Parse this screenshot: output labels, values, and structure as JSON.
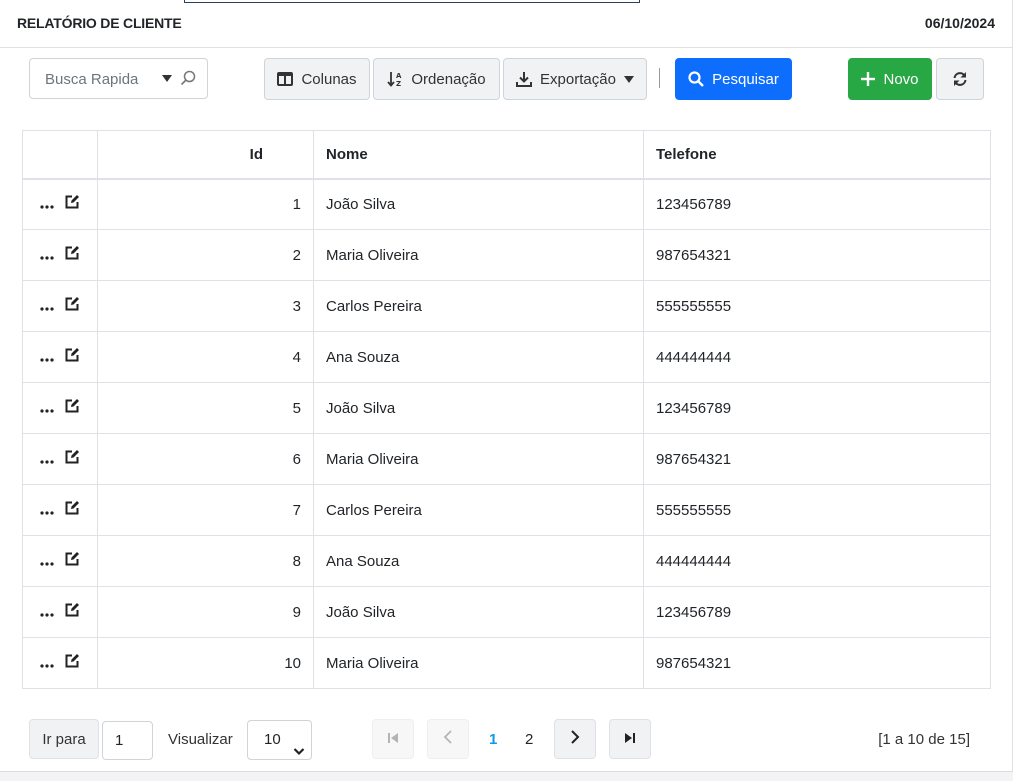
{
  "header": {
    "title": "RELATÓRIO DE CLIENTE",
    "date": "06/10/2024"
  },
  "toolbar": {
    "search_placeholder": "Busca Rapida",
    "columns_label": "Colunas",
    "sort_label": "Ordenação",
    "export_label": "Exportação",
    "search_label": "Pesquisar",
    "new_label": "Novo"
  },
  "table": {
    "columns": [
      "",
      "Id",
      "Nome",
      "Telefone"
    ],
    "rows": [
      {
        "id": "1",
        "nome": "João Silva",
        "telefone": "123456789"
      },
      {
        "id": "2",
        "nome": "Maria Oliveira",
        "telefone": "987654321"
      },
      {
        "id": "3",
        "nome": "Carlos Pereira",
        "telefone": "555555555"
      },
      {
        "id": "4",
        "nome": "Ana Souza",
        "telefone": "444444444"
      },
      {
        "id": "5",
        "nome": "João Silva",
        "telefone": "123456789"
      },
      {
        "id": "6",
        "nome": "Maria Oliveira",
        "telefone": "987654321"
      },
      {
        "id": "7",
        "nome": "Carlos Pereira",
        "telefone": "555555555"
      },
      {
        "id": "8",
        "nome": "Ana Souza",
        "telefone": "444444444"
      },
      {
        "id": "9",
        "nome": "João Silva",
        "telefone": "123456789"
      },
      {
        "id": "10",
        "nome": "Maria Oliveira",
        "telefone": "987654321"
      }
    ]
  },
  "footer": {
    "goto_label": "Ir para",
    "goto_value": "1",
    "view_label": "Visualizar",
    "page_size": "10",
    "pages": [
      "1",
      "2"
    ],
    "current_page": "1",
    "info": "[1 a 10 de 15]"
  },
  "colors": {
    "primary": "#0d6efd",
    "success": "#28a745",
    "active_page": "#0d9bea"
  },
  "icons": [
    "magnifier-icon",
    "caret-down-icon",
    "columns-icon",
    "sort-icon",
    "download-icon",
    "search-icon",
    "plus-icon",
    "refresh-icon",
    "more-icon",
    "edit-icon",
    "first-page-icon",
    "prev-page-icon",
    "next-page-icon",
    "last-page-icon"
  ]
}
